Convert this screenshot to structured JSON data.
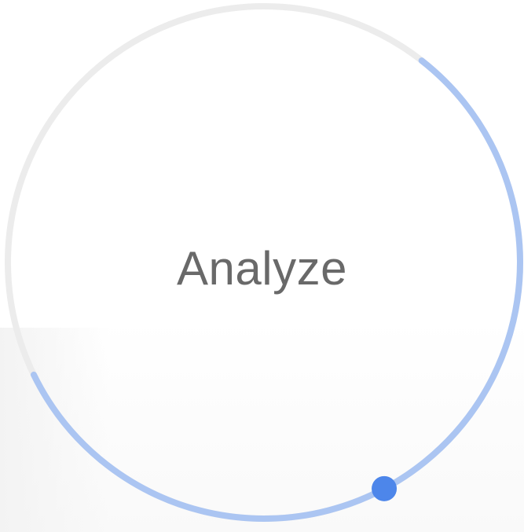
{
  "progress_ring": {
    "label": "Analyze",
    "progress_fraction": 0.35,
    "track_color": "#ececec",
    "progress_color": "#a8c3f2",
    "knob_color": "#4d86ea",
    "label_color": "#696969"
  }
}
